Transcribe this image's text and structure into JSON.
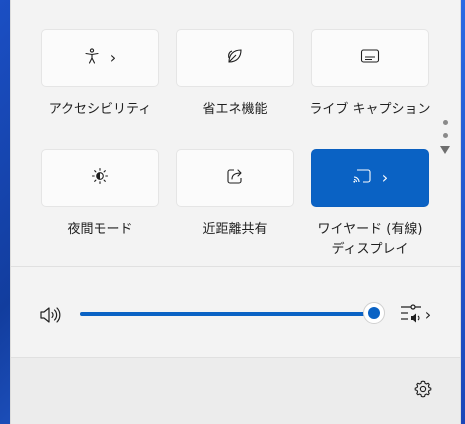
{
  "quick_settings": {
    "tiles": [
      {
        "label": "アクセシビリティ",
        "icon": "accessibility-icon",
        "has_chevron": true,
        "active": false
      },
      {
        "label": "省エネ機能",
        "icon": "leaf-icon",
        "has_chevron": false,
        "active": false
      },
      {
        "label": "ライブ キャプション",
        "icon": "captions-icon",
        "has_chevron": false,
        "active": false
      },
      {
        "label": "夜間モード",
        "icon": "night-light-icon",
        "has_chevron": false,
        "active": false
      },
      {
        "label": "近距離共有",
        "icon": "share-icon",
        "has_chevron": false,
        "active": false
      },
      {
        "label": "ワイヤード (有線)",
        "label_line2": "ディスプレイ",
        "icon": "cast-icon",
        "has_chevron": true,
        "active": true
      }
    ],
    "chevron": "›",
    "page_dots": 2
  },
  "volume": {
    "icon": "speaker-icon",
    "level": 1.0,
    "output_select_icon": "audio-output-icon",
    "chevron": "›"
  },
  "footer": {
    "settings_icon": "gear-icon"
  },
  "colors": {
    "accent": "#0a62c4",
    "panel_bg": "#f3f3f3",
    "tile_bg": "#fbfbfb"
  }
}
